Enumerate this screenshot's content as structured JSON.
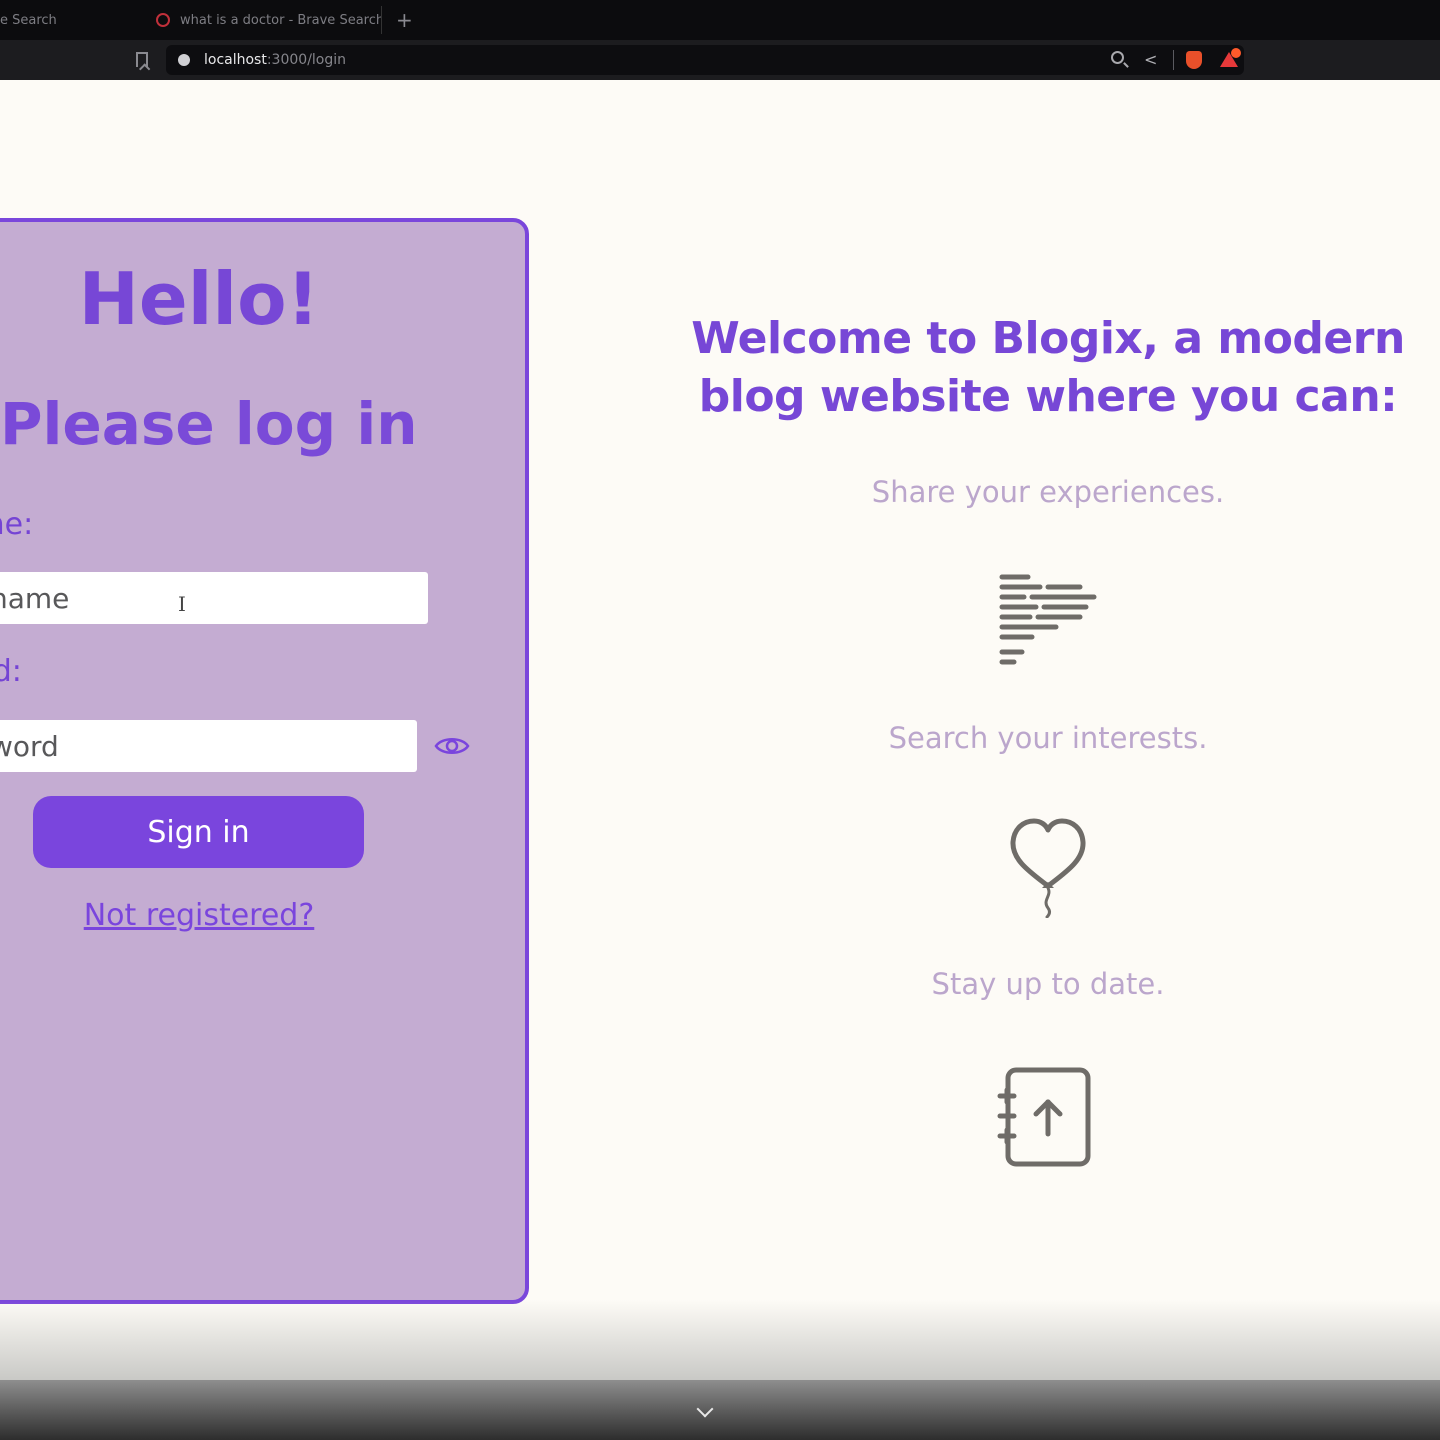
{
  "browser": {
    "tabs": [
      {
        "label": "e Search"
      },
      {
        "label": "what is a doctor - Brave Search"
      }
    ],
    "new_tab_label": "+",
    "url_host": "localhost",
    "url_path": ":3000/login"
  },
  "login": {
    "greeting": "Hello!",
    "subtitle": "Please log in",
    "username_label": "name:",
    "username_placeholder": "name",
    "password_label": "word:",
    "password_placeholder": "word",
    "signin_label": "Sign in",
    "register_link": "Not registered?"
  },
  "promo": {
    "headline": "Welcome to Blogix, a modern blog website where you can:",
    "features": [
      {
        "text": "Share your experiences.",
        "icon": "text-lines-icon"
      },
      {
        "text": "Search your interests.",
        "icon": "heart-balloon-icon"
      },
      {
        "text": "Stay up to date.",
        "icon": "notebook-upload-icon"
      }
    ]
  },
  "colors": {
    "accent": "#7a45dd",
    "card_background": "#c4acd2",
    "page_background": "#fdfbf6",
    "feature_text": "#bba6cc"
  }
}
